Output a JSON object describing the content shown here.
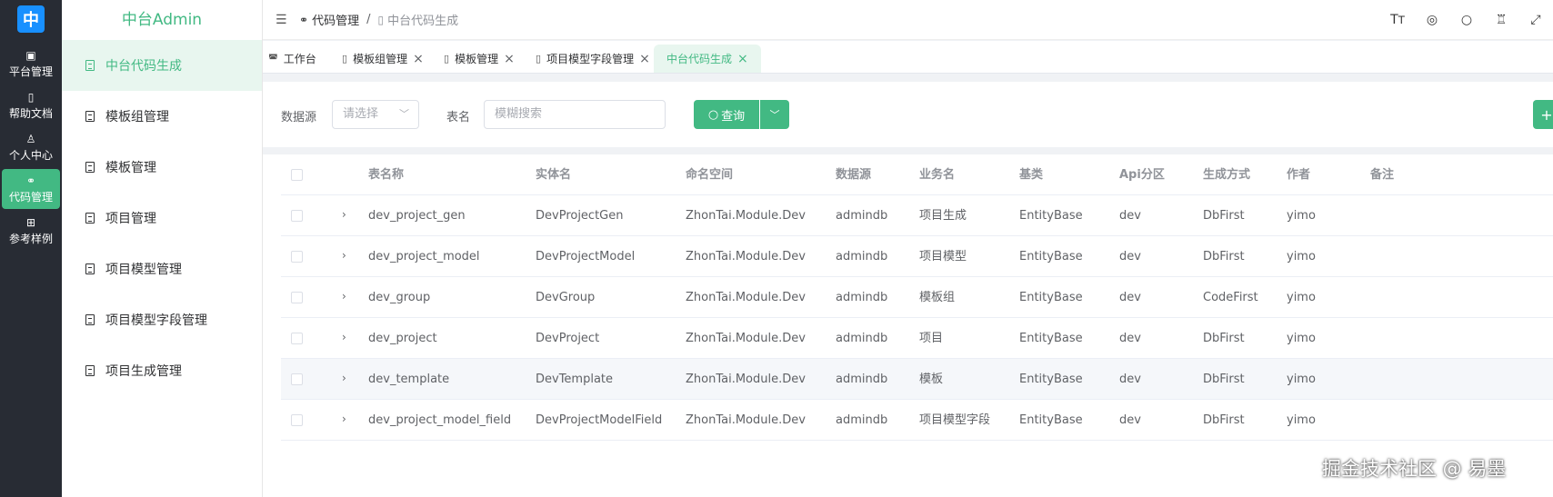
{
  "rail": {
    "logo": "中",
    "items": [
      {
        "icon": "monitor-icon",
        "glyph": "▣",
        "label": "平台管理"
      },
      {
        "icon": "book-icon",
        "glyph": "▯",
        "label": "帮助文档"
      },
      {
        "icon": "user-icon",
        "glyph": "♙",
        "label": "个人中心"
      },
      {
        "icon": "bike-icon",
        "glyph": "⚭",
        "label": "代码管理"
      },
      {
        "icon": "grid-icon",
        "glyph": "⊞",
        "label": "参考样例"
      }
    ]
  },
  "menu": {
    "title": "中台Admin",
    "items": [
      {
        "label": "中台代码生成"
      },
      {
        "label": "模板组管理"
      },
      {
        "label": "模板管理"
      },
      {
        "label": "项目管理"
      },
      {
        "label": "项目模型管理"
      },
      {
        "label": "项目模型字段管理"
      },
      {
        "label": "项目生成管理"
      }
    ]
  },
  "header": {
    "breadcrumb": [
      "代码管理",
      "中台代码生成"
    ],
    "separator": "/",
    "icons": [
      "font-size-icon",
      "globe-icon",
      "search-icon",
      "shirt-icon",
      "fullscreen-icon"
    ]
  },
  "tabs": [
    {
      "label": "工作台",
      "closable": false
    },
    {
      "label": "模板组管理",
      "closable": true
    },
    {
      "label": "模板管理",
      "closable": true
    },
    {
      "label": "项目模型字段管理",
      "closable": true
    },
    {
      "label": "中台代码生成",
      "closable": true,
      "active": true
    }
  ],
  "search": {
    "datasource_label": "数据源",
    "datasource_placeholder": "请选择",
    "table_label": "表名",
    "table_placeholder": "模糊搜索",
    "query_label": "查询"
  },
  "table": {
    "columns": [
      "表名称",
      "实体名",
      "命名空间",
      "数据源",
      "业务名",
      "基类",
      "Api分区",
      "生成方式",
      "作者",
      "备注"
    ],
    "rows": [
      [
        "dev_project_gen",
        "DevProjectGen",
        "ZhonTai.Module.Dev",
        "admindb",
        "项目生成",
        "EntityBase",
        "dev",
        "DbFirst",
        "yimo",
        ""
      ],
      [
        "dev_project_model",
        "DevProjectModel",
        "ZhonTai.Module.Dev",
        "admindb",
        "项目模型",
        "EntityBase",
        "dev",
        "DbFirst",
        "yimo",
        ""
      ],
      [
        "dev_group",
        "DevGroup",
        "ZhonTai.Module.Dev",
        "admindb",
        "模板组",
        "EntityBase",
        "dev",
        "CodeFirst",
        "yimo",
        ""
      ],
      [
        "dev_project",
        "DevProject",
        "ZhonTai.Module.Dev",
        "admindb",
        "项目",
        "EntityBase",
        "dev",
        "DbFirst",
        "yimo",
        ""
      ],
      [
        "dev_template",
        "DevTemplate",
        "ZhonTai.Module.Dev",
        "admindb",
        "模板",
        "EntityBase",
        "dev",
        "DbFirst",
        "yimo",
        ""
      ],
      [
        "dev_project_model_field",
        "DevProjectModelField",
        "ZhonTai.Module.Dev",
        "admindb",
        "项目模型字段",
        "EntityBase",
        "dev",
        "DbFirst",
        "yimo",
        ""
      ]
    ]
  },
  "watermark": "掘金技术社区 @ 易墨",
  "colors": {
    "accent": "#42b983",
    "rail": "#282c34",
    "logo": "#1890ff"
  }
}
